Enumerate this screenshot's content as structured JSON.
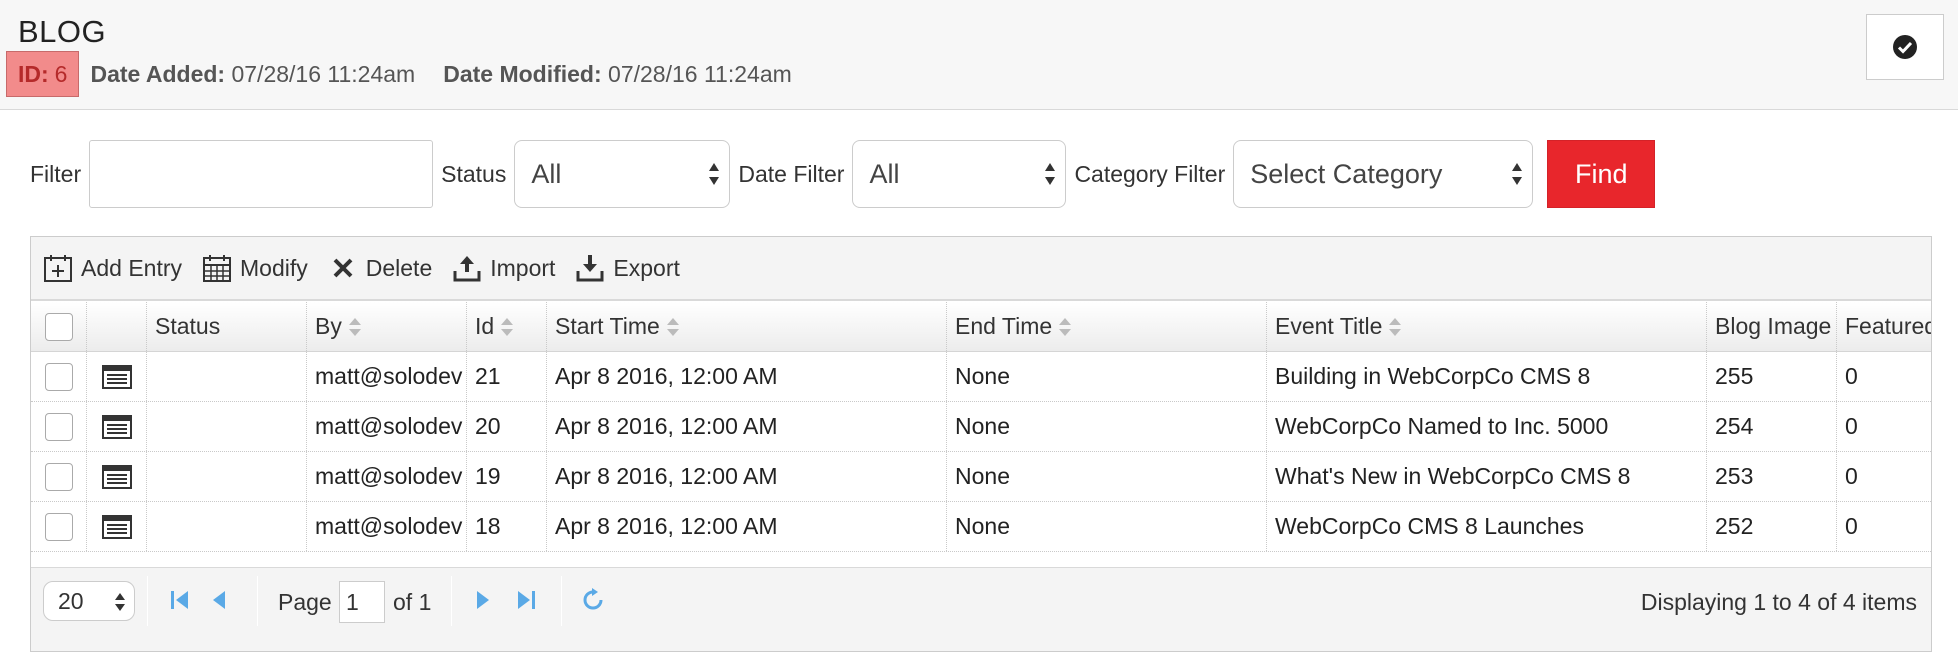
{
  "header": {
    "title": "BLOG",
    "id_label": "ID:",
    "id_value": "6",
    "date_added_label": "Date Added:",
    "date_added_value": "07/28/16 11:24am",
    "date_modified_label": "Date Modified:",
    "date_modified_value": "07/28/16 11:24am",
    "save_icon": "check-circle-icon"
  },
  "filters": {
    "filter_label": "Filter",
    "filter_value": "",
    "status_label": "Status",
    "status_value": "All",
    "date_filter_label": "Date Filter",
    "date_filter_value": "All",
    "category_filter_label": "Category Filter",
    "category_filter_value": "Select Category",
    "find_label": "Find",
    "find_color": "#e8262c"
  },
  "toolbar": {
    "add_entry": "Add Entry",
    "modify": "Modify",
    "delete": "Delete",
    "import": "Import",
    "export": "Export"
  },
  "grid": {
    "columns": [
      "",
      "",
      "Status",
      "By",
      "Id",
      "Start Time",
      "End Time",
      "Event Title",
      "Blog Image",
      "Featured"
    ],
    "rows": [
      {
        "status": "",
        "by": "matt@solodev",
        "id": "21",
        "start": "Apr 8 2016, 12:00 AM",
        "end": "None",
        "title": "Building in WebCorpCo CMS 8",
        "image": "255",
        "featured": "0"
      },
      {
        "status": "",
        "by": "matt@solodev",
        "id": "20",
        "start": "Apr 8 2016, 12:00 AM",
        "end": "None",
        "title": "WebCorpCo Named to Inc. 5000",
        "image": "254",
        "featured": "0"
      },
      {
        "status": "",
        "by": "matt@solodev",
        "id": "19",
        "start": "Apr 8 2016, 12:00 AM",
        "end": "None",
        "title": "What's New in WebCorpCo CMS 8",
        "image": "253",
        "featured": "0"
      },
      {
        "status": "",
        "by": "matt@solodev",
        "id": "18",
        "start": "Apr 8 2016, 12:00 AM",
        "end": "None",
        "title": "WebCorpCo CMS 8 Launches",
        "image": "252",
        "featured": "0"
      }
    ]
  },
  "pager": {
    "page_size": "20",
    "page_label": "Page",
    "page_value": "1",
    "of_label": "of 1",
    "display_info": "Displaying 1 to 4 of 4 items",
    "icon_color": "#5aa9e6"
  }
}
